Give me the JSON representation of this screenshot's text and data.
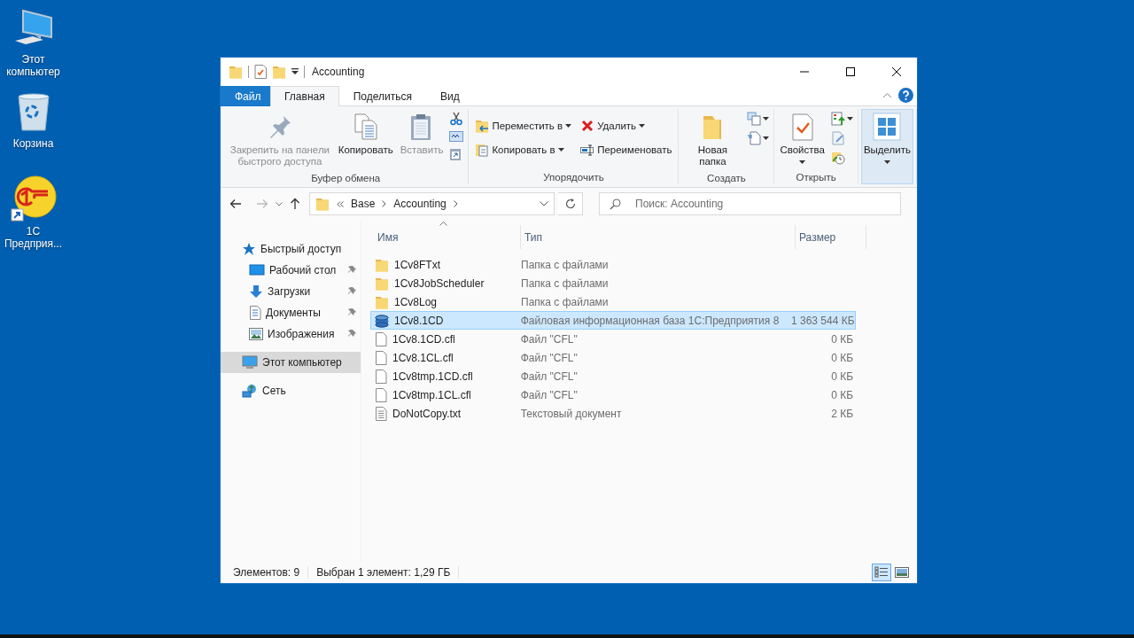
{
  "desktop_icons": [
    {
      "kind": "computer",
      "label": "Этот компьютер"
    },
    {
      "kind": "recycle",
      "label": "Корзина"
    },
    {
      "kind": "app",
      "label": "1С Предприя...",
      "shortcut": true
    }
  ],
  "window": {
    "title": "Accounting"
  },
  "ribbon": {
    "tabs": [
      {
        "label": "Файл",
        "kind": "file",
        "selected": false
      },
      {
        "label": "Главная",
        "kind": "tab",
        "selected": true
      },
      {
        "label": "Поделиться",
        "kind": "tab",
        "selected": false
      },
      {
        "label": "Вид",
        "kind": "tab",
        "selected": false
      }
    ],
    "groups": [
      {
        "label": "Буфер обмена",
        "items": [
          {
            "kind": "pin",
            "label": "Закрепить на панели быстрого доступа",
            "disabled": true
          },
          {
            "kind": "copy",
            "label": "Копировать",
            "disabled": false
          },
          {
            "kind": "paste",
            "label": "Вставить",
            "disabled": true
          },
          {
            "kind": "cut"
          },
          {
            "kind": "copy-path"
          },
          {
            "kind": "paste-shortcut"
          }
        ]
      },
      {
        "label": "Упорядочить",
        "items": [
          {
            "kind": "move",
            "label": "Переместить в",
            "dropdown": true
          },
          {
            "kind": "copy-to",
            "label": "Копировать в",
            "dropdown": true
          },
          {
            "kind": "delete",
            "label": "Удалить",
            "dropdown": true
          },
          {
            "kind": "rename",
            "label": "Переименовать",
            "dropdown": false
          }
        ]
      },
      {
        "label": "Создать",
        "items": [
          {
            "kind": "new-folder",
            "label": "Новая папка",
            "disabled": false
          },
          {
            "kind": "new-item",
            "dropdown": true
          },
          {
            "kind": "easy-access",
            "dropdown": true
          }
        ]
      },
      {
        "label": "Открыть",
        "items": [
          {
            "kind": "properties",
            "label": "Свойства",
            "disabled": false,
            "dropdown": true
          },
          {
            "kind": "open",
            "dropdown": true
          },
          {
            "kind": "edit"
          },
          {
            "kind": "history"
          }
        ]
      },
      {
        "items": [
          {
            "kind": "select",
            "label": "Выделить",
            "disabled": false,
            "dropdown": true,
            "hovered": true
          }
        ]
      }
    ]
  },
  "address": {
    "crumbs": [
      "Base",
      "Accounting"
    ],
    "search": {
      "placeholder": "Поиск: Accounting"
    }
  },
  "navigation": [
    {
      "label": "Быстрый доступ",
      "kind": "star",
      "selected": false,
      "children": [
        {
          "label": "Рабочий стол",
          "kind": "desktop",
          "selected": false,
          "pinned": true
        },
        {
          "label": "Загрузки",
          "kind": "download",
          "selected": false,
          "pinned": true
        },
        {
          "label": "Документы",
          "kind": "documents",
          "selected": false,
          "pinned": true
        },
        {
          "label": "Изображения",
          "kind": "pictures",
          "selected": false,
          "pinned": true
        }
      ]
    },
    {
      "label": "Этот компьютер",
      "kind": "computer",
      "selected": true
    },
    {
      "label": "Сеть",
      "kind": "network",
      "selected": false
    }
  ],
  "table": {
    "columns": [
      {
        "label": "Имя",
        "sorted": true
      },
      {
        "label": "Тип",
        "sorted": false
      },
      {
        "label": "Размер",
        "sorted": false
      }
    ],
    "rows": [
      {
        "name": "1Cv8FTxt",
        "kind": "folder",
        "type": "Папка с файлами",
        "selected": false
      },
      {
        "name": "1Cv8JobScheduler",
        "kind": "folder",
        "type": "Папка с файлами",
        "selected": false
      },
      {
        "name": "1Cv8Log",
        "kind": "folder",
        "type": "Папка с файлами",
        "selected": false
      },
      {
        "name": "1Cv8.1CD",
        "kind": "database",
        "type": "Файловая информационная база 1С:Предприятия 8",
        "size": "1 363 544 КБ",
        "selected": true
      },
      {
        "name": "1Cv8.1CD.cfl",
        "kind": "file",
        "type": "Файл \"CFL\"",
        "size": "0 КБ",
        "selected": false
      },
      {
        "name": "1Cv8.1CL.cfl",
        "kind": "file",
        "type": "Файл \"CFL\"",
        "size": "0 КБ",
        "selected": false
      },
      {
        "name": "1Cv8tmp.1CD.cfl",
        "kind": "file",
        "type": "Файл \"CFL\"",
        "size": "0 КБ",
        "selected": false
      },
      {
        "name": "1Cv8tmp.1CL.cfl",
        "kind": "file",
        "type": "Файл \"CFL\"",
        "size": "0 КБ",
        "selected": false
      },
      {
        "name": "DoNotCopy.txt",
        "kind": "text",
        "type": "Текстовый документ",
        "size": "2 КБ",
        "selected": false
      }
    ]
  },
  "status_bar": {
    "items": [
      "Элементов: 9",
      "Выбран 1 элемент: 1,29 ГБ"
    ],
    "views": [
      {
        "kind": "details",
        "selected": true
      },
      {
        "kind": "tiles",
        "selected": false
      }
    ]
  }
}
